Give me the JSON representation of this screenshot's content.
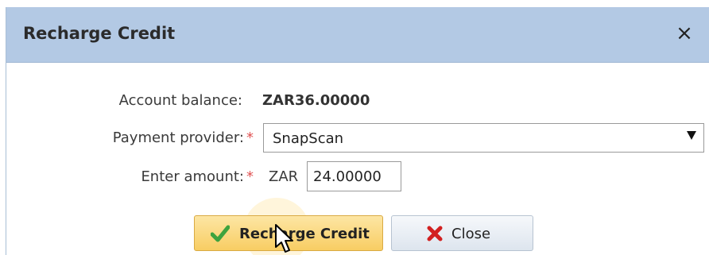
{
  "dialog": {
    "title": "Recharge Credit",
    "close_icon": "×"
  },
  "form": {
    "balance_label": "Account balance:",
    "balance_value": "ZAR36.00000",
    "provider_label": "Payment provider:",
    "provider_value": "SnapScan",
    "amount_label": "Enter amount:",
    "currency": "ZAR",
    "amount_value": "24.00000",
    "required_mark": "*"
  },
  "buttons": {
    "recharge_label": "Recharge Credit",
    "close_label": "Close"
  },
  "icons": {
    "checkmark": "checkmark-icon",
    "close": "red-x-icon",
    "cursor": "mouse-pointer-icon"
  },
  "colors": {
    "titlebar": "#b3c9e4",
    "primary_button": "#f8cd63",
    "required": "#e05252",
    "check": "#3ea33e",
    "close_x": "#d22020"
  }
}
